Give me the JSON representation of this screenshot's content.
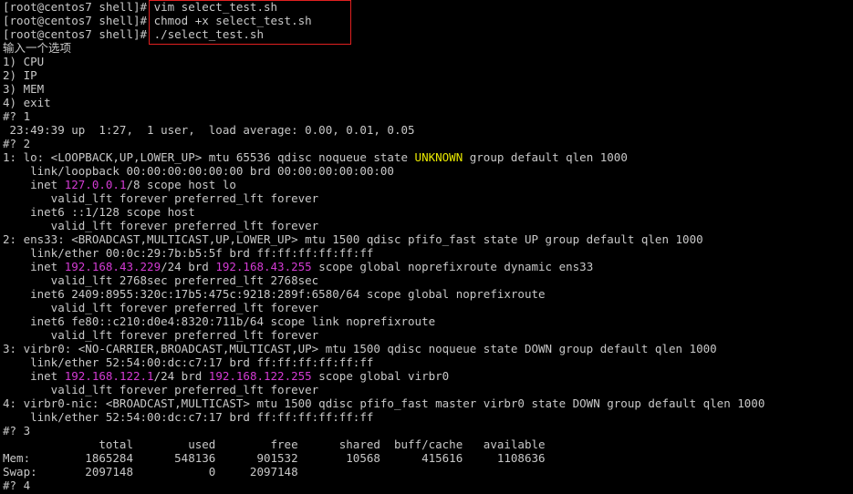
{
  "terminal": {
    "colors": {
      "background": "#000000",
      "text": "#c8c8c8",
      "magenta": "#d33bd3",
      "yellow": "#e8e800",
      "highlight_border": "#e02020"
    },
    "lines": [
      [
        {
          "t": "[root@centos7 shell]# vim select_test.sh"
        }
      ],
      [
        {
          "t": "[root@centos7 shell]# chmod +x select_test.sh"
        }
      ],
      [
        {
          "t": "[root@centos7 shell]# ./select_test.sh"
        }
      ],
      [
        {
          "t": "输入一个选项"
        }
      ],
      [
        {
          "t": "1) CPU"
        }
      ],
      [
        {
          "t": "2) IP"
        }
      ],
      [
        {
          "t": "3) MEM"
        }
      ],
      [
        {
          "t": "4) exit"
        }
      ],
      [
        {
          "t": "#? 1"
        }
      ],
      [
        {
          "t": " 23:49:39 up  1:27,  1 user,  load average: 0.00, 0.01, 0.05"
        }
      ],
      [
        {
          "t": "#? 2"
        }
      ],
      [
        {
          "t": "1: lo: <LOOPBACK,UP,LOWER_UP> mtu 65536 qdisc noqueue state "
        },
        {
          "t": "UNKNOWN",
          "c": "yellow"
        },
        {
          "t": " group default qlen 1000"
        }
      ],
      [
        {
          "t": "    link/loopback 00:00:00:00:00:00 brd 00:00:00:00:00:00"
        }
      ],
      [
        {
          "t": "    inet "
        },
        {
          "t": "127.0.0.1",
          "c": "magenta"
        },
        {
          "t": "/8 scope host lo"
        }
      ],
      [
        {
          "t": "       valid_lft forever preferred_lft forever"
        }
      ],
      [
        {
          "t": "    inet6 ::1/128 scope host"
        }
      ],
      [
        {
          "t": "       valid_lft forever preferred_lft forever"
        }
      ],
      [
        {
          "t": "2: ens33: <BROADCAST,MULTICAST,UP,LOWER_UP> mtu 1500 qdisc pfifo_fast state UP group default qlen 1000"
        }
      ],
      [
        {
          "t": "    link/ether 00:0c:29:7b:b5:5f brd ff:ff:ff:ff:ff:ff"
        }
      ],
      [
        {
          "t": "    inet "
        },
        {
          "t": "192.168.43.229",
          "c": "magenta"
        },
        {
          "t": "/24 brd "
        },
        {
          "t": "192.168.43.255",
          "c": "magenta"
        },
        {
          "t": " scope global noprefixroute dynamic ens33"
        }
      ],
      [
        {
          "t": "       valid_lft 2768sec preferred_lft 2768sec"
        }
      ],
      [
        {
          "t": "    inet6 2409:8955:320c:17b5:475c:9218:289f:6580/64 scope global noprefixroute"
        }
      ],
      [
        {
          "t": "       valid_lft forever preferred_lft forever"
        }
      ],
      [
        {
          "t": "    inet6 fe80::c210:d0e4:8320:711b/64 scope link noprefixroute"
        }
      ],
      [
        {
          "t": "       valid_lft forever preferred_lft forever"
        }
      ],
      [
        {
          "t": "3: virbr0: <NO-CARRIER,BROADCAST,MULTICAST,UP> mtu 1500 qdisc noqueue state DOWN group default qlen 1000"
        }
      ],
      [
        {
          "t": "    link/ether 52:54:00:dc:c7:17 brd ff:ff:ff:ff:ff:ff"
        }
      ],
      [
        {
          "t": "    inet "
        },
        {
          "t": "192.168.122.1",
          "c": "magenta"
        },
        {
          "t": "/24 brd "
        },
        {
          "t": "192.168.122.255",
          "c": "magenta"
        },
        {
          "t": " scope global virbr0"
        }
      ],
      [
        {
          "t": "       valid_lft forever preferred_lft forever"
        }
      ],
      [
        {
          "t": "4: virbr0-nic: <BROADCAST,MULTICAST> mtu 1500 qdisc pfifo_fast master virbr0 state DOWN group default qlen 1000"
        }
      ],
      [
        {
          "t": "    link/ether 52:54:00:dc:c7:17 brd ff:ff:ff:ff:ff:ff"
        }
      ],
      [
        {
          "t": "#? 3"
        }
      ],
      [
        {
          "t": "              total        used        free      shared  buff/cache   available"
        }
      ],
      [
        {
          "t": "Mem:        1865284      548136      901532       10568      415616     1108636"
        }
      ],
      [
        {
          "t": "Swap:       2097148           0     2097148"
        }
      ],
      [
        {
          "t": "#? 4"
        }
      ]
    ]
  }
}
